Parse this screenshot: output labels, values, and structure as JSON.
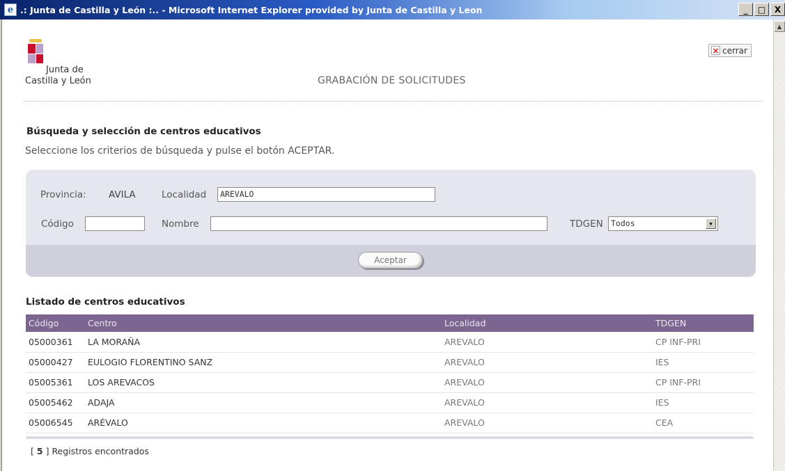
{
  "window": {
    "title": ".: Junta de Castilla y León :.. - Microsoft Internet Explorer provided by Junta de Castilla y Leon",
    "minimize_label": "_",
    "maximize_label": "□",
    "close_label": "X",
    "icon": "ie-icon"
  },
  "header": {
    "logo_line1": "Junta de",
    "logo_line2": "Castilla y León",
    "close_label": "cerrar",
    "close_icon": "close-icon",
    "page_title": "GRABACIÓN DE SOLICITUDES"
  },
  "search": {
    "section_title": "Búsqueda y selección de centros educativos",
    "instructions": "Seleccione los criterios de búsqueda y pulse el botón ACEPTAR.",
    "province_label": "Provincia:",
    "province_value": "AVILA",
    "locality_label": "Localidad",
    "locality_value": "AREVALO",
    "code_label": "Código",
    "code_value": "",
    "name_label": "Nombre",
    "name_value": "",
    "tdgen_label": "TDGEN",
    "tdgen_value": "Todos",
    "accept_label": "Aceptar"
  },
  "list": {
    "title": "Listado de centros educativos",
    "columns": [
      "Código",
      "Centro",
      "Localidad",
      "TDGEN"
    ],
    "rows": [
      {
        "code": "05000361",
        "name": "LA MORAÑA",
        "locality": "AREVALO",
        "type": "CP INF-PRI"
      },
      {
        "code": "05000427",
        "name": "EULOGIO FLORENTINO SANZ",
        "locality": "AREVALO",
        "type": "IES"
      },
      {
        "code": "05005361",
        "name": "LOS AREVACOS",
        "locality": "AREVALO",
        "type": "CP INF-PRI"
      },
      {
        "code": "05005462",
        "name": "ADAJA",
        "locality": "AREVALO",
        "type": "IES"
      },
      {
        "code": "05006545",
        "name": "ARÉVALO",
        "locality": "AREVALO",
        "type": "CEA"
      }
    ],
    "records_open": "[",
    "records_count": "5",
    "records_close": "]",
    "records_text": "Registros encontrados"
  },
  "colors": {
    "title_bar": "#0a246a",
    "table_header": "#7a6690",
    "panel": "#e6e6ee",
    "brand_red": "#c8102e"
  }
}
